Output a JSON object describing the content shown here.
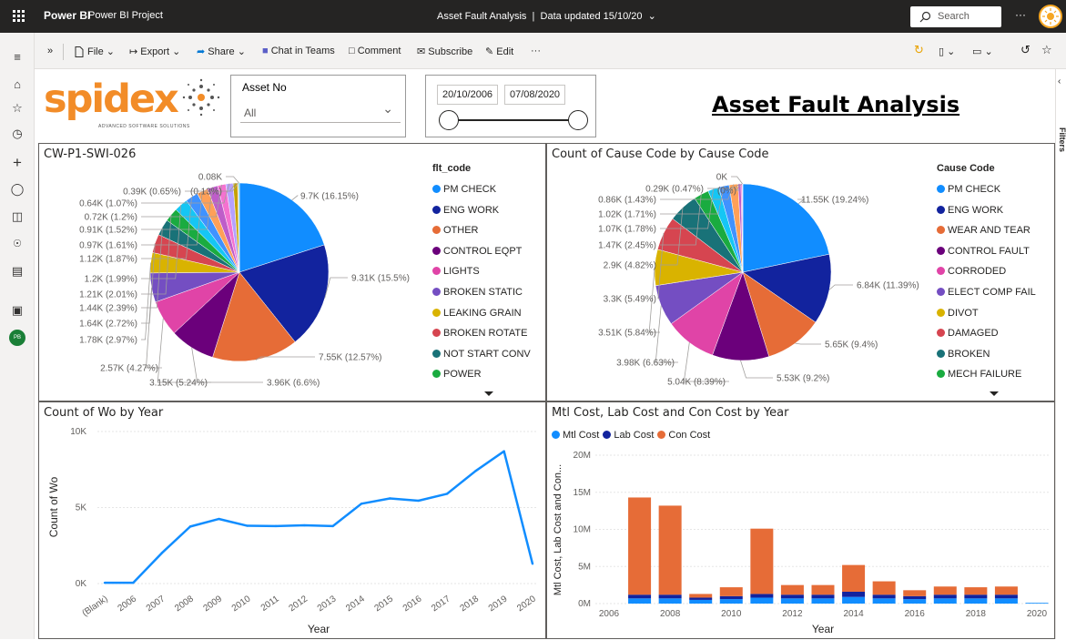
{
  "topbar": {
    "brand": "Power BI",
    "project": "Power BI Project",
    "report_title": "Asset Fault Analysis",
    "updated": "Data updated 15/10/20",
    "search_placeholder": "Search",
    "more": "···"
  },
  "toolbar": {
    "file": "File",
    "export": "Export",
    "share": "Share",
    "chat": "Chat in Teams",
    "comment": "Comment",
    "subscribe": "Subscribe",
    "edit": "Edit",
    "more": "···"
  },
  "rail": {
    "avatar": "PB"
  },
  "filters_pane": {
    "label": "Filters"
  },
  "logo": {
    "text": "spidex",
    "tagline": "ADVANCED SOFTWARE SOLUTIONS"
  },
  "asset_slicer": {
    "label": "Asset No",
    "value": "All"
  },
  "date_slicer": {
    "start": "20/10/2006",
    "end": "07/08/2020"
  },
  "page_title": "Asset Fault Analysis",
  "colors": {
    "accent": "#f28c28",
    "blue": "#118DFF",
    "navy": "#12239E",
    "orange": "#E66C37"
  },
  "chart_data": [
    {
      "type": "pie",
      "title": "CW-P1-SWI-026",
      "legend_title": "flt_code",
      "legend": [
        "PM CHECK",
        "ENG WORK",
        "OTHER",
        "CONTROL EQPT",
        "LIGHTS",
        "BROKEN STATIC",
        "LEAKING GRAIN",
        "BROKEN ROTATE",
        "NOT START CONV",
        "POWER"
      ],
      "slices": [
        {
          "label": "9.7K (16.15%)",
          "value": 16.15
        },
        {
          "label": "9.31K (15.5%)",
          "value": 15.5
        },
        {
          "label": "7.55K (12.57%)",
          "value": 12.57
        },
        {
          "label": "3.96K (6.6%)",
          "value": 6.6
        },
        {
          "label": "3.15K (5.24%)",
          "value": 5.24
        },
        {
          "label": "2.57K (4.27%)",
          "value": 4.27
        },
        {
          "label": "1.78K (2.97%)",
          "value": 2.97
        },
        {
          "label": "1.64K (2.72%)",
          "value": 2.72
        },
        {
          "label": "1.44K (2.39%)",
          "value": 2.39
        },
        {
          "label": "1.21K (2.01%)",
          "value": 2.01
        },
        {
          "label": "1.2K (1.99%)",
          "value": 1.99
        },
        {
          "label": "1.12K (1.87%)",
          "value": 1.87
        },
        {
          "label": "0.97K (1.61%)",
          "value": 1.61
        },
        {
          "label": "0.91K (1.52%)",
          "value": 1.52
        },
        {
          "label": "0.72K (1.2%)",
          "value": 1.2
        },
        {
          "label": "0.64K (1.07%)",
          "value": 1.07
        },
        {
          "label": "0.39K (0.65%)",
          "value": 0.65
        },
        {
          "label": "(0.13%)",
          "value": 0.13
        },
        {
          "label": "0.08K",
          "value": 0.13
        }
      ]
    },
    {
      "type": "pie",
      "title": "Count of Cause Code by Cause Code",
      "legend_title": "Cause Code",
      "legend": [
        "PM CHECK",
        "ENG WORK",
        "WEAR AND TEAR",
        "CONTROL FAULT",
        "CORRODED",
        "ELECT COMP FAIL",
        "DIVOT",
        "DAMAGED",
        "BROKEN",
        "MECH FAILURE"
      ],
      "slices": [
        {
          "label": "11.55K (19.24%)",
          "value": 19.24
        },
        {
          "label": "6.84K (11.39%)",
          "value": 11.39
        },
        {
          "label": "5.65K (9.4%)",
          "value": 9.4
        },
        {
          "label": "5.53K (9.2%)",
          "value": 9.2
        },
        {
          "label": "5.04K (8.39%)",
          "value": 8.39
        },
        {
          "label": "3.98K (6.63%)",
          "value": 6.63
        },
        {
          "label": "3.51K (5.84%)",
          "value": 5.84
        },
        {
          "label": "3.3K (5.49%)",
          "value": 5.49
        },
        {
          "label": "2.9K (4.82%)",
          "value": 4.82
        },
        {
          "label": "1.47K (2.45%)",
          "value": 2.45
        },
        {
          "label": "1.07K (1.78%)",
          "value": 1.78
        },
        {
          "label": "1.02K (1.71%)",
          "value": 1.71
        },
        {
          "label": "0.86K (1.43%)",
          "value": 1.43
        },
        {
          "label": "0.29K (0.47%)",
          "value": 0.47
        },
        {
          "label": "(0%)",
          "value": 0.2
        },
        {
          "label": "0K",
          "value": 0.1
        }
      ]
    },
    {
      "type": "line",
      "title": "Count of Wo by Year",
      "xlabel": "Year",
      "ylabel": "Count of Wo",
      "categories": [
        "(Blank)",
        "2006",
        "2007",
        "2008",
        "2009",
        "2010",
        "2011",
        "2012",
        "2013",
        "2014",
        "2015",
        "2016",
        "2017",
        "2018",
        "2019",
        "2020"
      ],
      "values": [
        50,
        50,
        2000,
        3750,
        4250,
        3800,
        3780,
        3830,
        3780,
        5250,
        5600,
        5450,
        5900,
        7400,
        8700,
        1300
      ],
      "yticks": [
        "0K",
        "5K",
        "10K"
      ],
      "ylim": [
        0,
        10000
      ],
      "series_color": "#118DFF"
    },
    {
      "type": "bar",
      "stacked": true,
      "title": "Mtl Cost, Lab Cost and Con Cost by Year",
      "xlabel": "Year",
      "ylabel": "Mtl Cost, Lab Cost and Con...",
      "yticks": [
        "0M",
        "5M",
        "10M",
        "15M",
        "20M"
      ],
      "ylim": [
        0,
        20000000
      ],
      "xticks": [
        "2006",
        "2008",
        "2010",
        "2012",
        "2014",
        "2016",
        "2018",
        "2020"
      ],
      "categories": [
        "2006",
        "2007",
        "2008",
        "2009",
        "2010",
        "2011",
        "2012",
        "2013",
        "2014",
        "2015",
        "2016",
        "2017",
        "2018",
        "2019",
        "2020"
      ],
      "series": [
        {
          "name": "Mtl Cost",
          "color": "#118DFF",
          "values": [
            0,
            700000,
            700000,
            500000,
            600000,
            800000,
            700000,
            700000,
            900000,
            700000,
            600000,
            700000,
            700000,
            700000,
            100000
          ]
        },
        {
          "name": "Lab Cost",
          "color": "#12239E",
          "values": [
            0,
            500000,
            500000,
            300000,
            400000,
            500000,
            500000,
            500000,
            700000,
            500000,
            400000,
            500000,
            500000,
            500000,
            0
          ]
        },
        {
          "name": "Con Cost",
          "color": "#E66C37",
          "values": [
            0,
            13100000,
            12000000,
            500000,
            1200000,
            8800000,
            1300000,
            1300000,
            3600000,
            1800000,
            800000,
            1100000,
            1000000,
            1100000,
            0
          ]
        }
      ]
    }
  ]
}
